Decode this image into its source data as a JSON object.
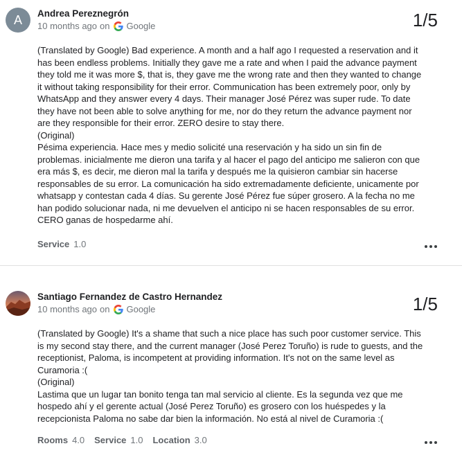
{
  "reviews": [
    {
      "avatar_letter": "A",
      "author": "Andrea Pereznegrón",
      "time": "10 months ago",
      "on_label": "on",
      "source": "Google",
      "rating": "1/5",
      "text": "(Translated by Google) Bad experience. A month and a half ago I requested a reservation and it\nhas been endless problems. Initially they gave me a rate and when I paid the advance payment\nthey told me it was more $, that is, they gave me the wrong rate and then they wanted to change\nit without taking responsibility for their error. Communication has been extremely poor, only by\nWhatsApp and they answer every 4 days. Their manager José Pérez was super rude. To date\nthey have not been able to solve anything for me, nor do they return the advance payment nor\nare they responsible for their error. ZERO desire to stay there.\n(Original)\nPésima experiencia. Hace mes y medio solicité una reservación y ha sido un sin fin de\nproblemas. inicialmente me dieron una tarifa y al hacer el pago del anticipo me salieron con que\nera más $, es decir, me dieron mal la tarifa y después me la quisieron cambiar sin hacerse\nresponsables de su error. La comunicación ha sido extremadamente deficiente, unicamente por\nwhatsapp y contestan cada 4 días. Su gerente José Pérez fue súper grosero. A la fecha no me\nhan podido solucionar nada, ni me devuelven el anticipo ni se hacen responsables de su error.\nCERO ganas de hospedarme ahí.",
      "aspects": [
        {
          "label": "Service",
          "value": "1.0"
        }
      ]
    },
    {
      "author": "Santiago Fernandez de Castro Hernandez",
      "time": "10 months ago",
      "on_label": "on",
      "source": "Google",
      "rating": "1/5",
      "text": "(Translated by Google) It's a shame that such a nice place has such poor customer service. This\nis my second stay there, and the current manager (José Perez Toruño) is rude to guests, and the\nreceptionist, Paloma, is incompetent at providing information. It's not on the same level as\nCuramoria :(\n(Original)\nLastima que un lugar tan bonito tenga tan mal servicio al cliente. Es la segunda vez que me\nhospedo ahí y el gerente actual (José Perez Toruño) es grosero con los huéspedes y la\nrecepcionista Paloma no sabe dar bien la información. No está al nivel de Curamoria :(",
      "aspects": [
        {
          "label": "Rooms",
          "value": "4.0"
        },
        {
          "label": "Service",
          "value": "1.0"
        },
        {
          "label": "Location",
          "value": "3.0"
        }
      ]
    }
  ],
  "icons": {
    "google": "google-g-icon",
    "more": "more-vert-icon"
  }
}
